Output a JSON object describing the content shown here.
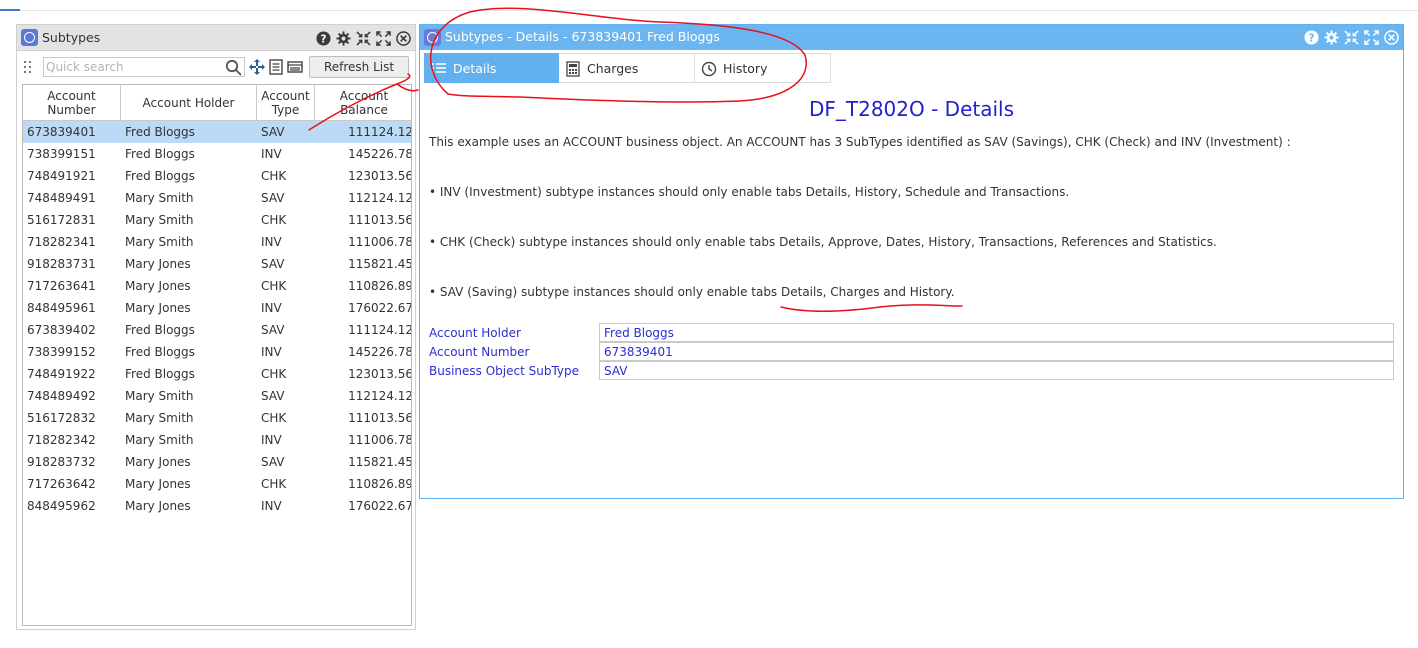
{
  "left_panel": {
    "title": "Subtypes",
    "search_placeholder": "Quick search",
    "refresh_label": "Refresh List",
    "columns": [
      "Account Number",
      "Account Holder",
      "Account Type",
      "Account Balance"
    ],
    "rows": [
      [
        "673839401",
        "Fred Bloggs",
        "SAV",
        "111124.12"
      ],
      [
        "738399151",
        "Fred Bloggs",
        "INV",
        "145226.78"
      ],
      [
        "748491921",
        "Fred Bloggs",
        "CHK",
        "123013.56"
      ],
      [
        "748489491",
        "Mary Smith",
        "SAV",
        "112124.12"
      ],
      [
        "516172831",
        "Mary Smith",
        "CHK",
        "111013.56"
      ],
      [
        "718282341",
        "Mary Smith",
        "INV",
        "111006.78"
      ],
      [
        "918283731",
        "Mary Jones",
        "SAV",
        "115821.45"
      ],
      [
        "717263641",
        "Mary Jones",
        "CHK",
        "110826.89"
      ],
      [
        "848495961",
        "Mary Jones",
        "INV",
        "176022.67"
      ],
      [
        "673839402",
        "Fred Bloggs",
        "SAV",
        "111124.12"
      ],
      [
        "738399152",
        "Fred Bloggs",
        "INV",
        "145226.78"
      ],
      [
        "748491922",
        "Fred Bloggs",
        "CHK",
        "123013.56"
      ],
      [
        "748489492",
        "Mary Smith",
        "SAV",
        "112124.12"
      ],
      [
        "516172832",
        "Mary Smith",
        "CHK",
        "111013.56"
      ],
      [
        "718282342",
        "Mary Smith",
        "INV",
        "111006.78"
      ],
      [
        "918283732",
        "Mary Jones",
        "SAV",
        "115821.45"
      ],
      [
        "717263642",
        "Mary Jones",
        "CHK",
        "110826.89"
      ],
      [
        "848495962",
        "Mary Jones",
        "INV",
        "176022.67"
      ]
    ],
    "selected_row": 0
  },
  "right_panel": {
    "title": "Subtypes - Details - 673839401 Fred Bloggs",
    "tabs": [
      {
        "label": "Details",
        "icon": "list-icon",
        "active": true
      },
      {
        "label": "Charges",
        "icon": "calculator-icon",
        "active": false
      },
      {
        "label": "History",
        "icon": "clock-icon",
        "active": false
      }
    ],
    "heading": "DF_T2802O - Details",
    "paragraphs": [
      "This example uses an ACCOUNT business object. An ACCOUNT has 3 SubTypes identified as SAV (Savings), CHK (Check) and INV (Investment) :",
      "• INV (Investment) subtype instances should only enable tabs Details, History, Schedule and Transactions.",
      "• CHK (Check) subtype instances should only enable tabs Details, Approve, Dates, History, Transactions, References and Statistics.",
      "• SAV (Saving) subtype instances should only enable tabs Details, Charges and History."
    ],
    "form": [
      {
        "label": "Account Holder",
        "value": "Fred Bloggs"
      },
      {
        "label": "Account Number",
        "value": "673839401"
      },
      {
        "label": "Business Object SubType",
        "value": "SAV"
      }
    ]
  },
  "colors": {
    "accent": "#62b0ee",
    "selected_row": "#bcd9f5",
    "link_blue": "#2d2dd0",
    "annotation_red": "#e8101a"
  }
}
